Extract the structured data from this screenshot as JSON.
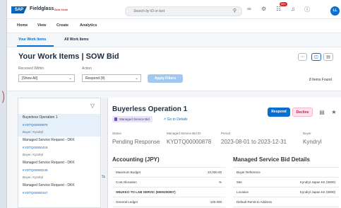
{
  "app": {
    "brand": "SAP",
    "name": "Fieldglass",
    "beta": "Beta Mode",
    "avatar": "LL",
    "notif_count": "99+"
  },
  "search": {
    "placeholder": "Search by ID or text"
  },
  "nav": {
    "items": [
      "Home",
      "View",
      "Create",
      "Analytics"
    ]
  },
  "tabs": {
    "items": [
      "Your Work Items",
      "All Work Items"
    ],
    "active": 0
  },
  "header": {
    "title": "Your Work Items | SOW Bid",
    "received_within_label": "Received Within",
    "received_within_value": "[Show All]",
    "action_label": "Action",
    "action_value": "Respond (8)",
    "apply_filters": "Apply Filters",
    "items_found": "8 Items Found"
  },
  "list": {
    "items": [
      {
        "title": "Buyerless Operation 1",
        "id": "KYDTQ00000878",
        "buyer": "Buyer: Kyndryl"
      },
      {
        "title": "Managed Service Request - DKK",
        "id": "KYDTQ00000418",
        "buyer": "Buyer: Kyndryl"
      },
      {
        "title": "Managed Service Request - DKK",
        "id": "KYDTQ00000249",
        "buyer": "Buyer: Kyndryl"
      },
      {
        "title": "Managed Service Request - DKK",
        "id": "KYDTQ00000167",
        "buyer": ""
      }
    ]
  },
  "detail": {
    "title": "Buyerless Operation 1",
    "tag": "Managed Service Bid",
    "goto": "Go to Details",
    "respond": "Respond",
    "decline": "Decline",
    "fields": [
      {
        "label": "Status",
        "value": "Pending Response"
      },
      {
        "label": "Managed Service Bid ID",
        "value": "KYDTQ00000878"
      },
      {
        "label": "Period",
        "value": "2023-08-01 to 2023-12-31"
      },
      {
        "label": "Buyer",
        "value": "Kyndryl"
      }
    ],
    "accounting": {
      "title": "Accounting (JPY)",
      "rows": [
        {
          "k": "Maximum Budget",
          "v": "10,000.00"
        },
        {
          "k": "Cost Allocation",
          "v": "%"
        },
        {
          "k": "SHUKKO TO LAB SERVIC (5000200007)",
          "v": ""
        },
        {
          "k": "General Ledger",
          "v": "100.000"
        }
      ]
    },
    "msbd": {
      "title": "Managed Service Bid Details",
      "rows": [
        {
          "k": "Buyer Reference",
          "v": ""
        },
        {
          "k": "Site",
          "v": "Kyndryl Japan KK (5000)"
        },
        {
          "k": "Location",
          "v": "Kyndryl Japan KK (5000)"
        },
        {
          "k": "Default Remit-to Address",
          "v": ""
        }
      ]
    }
  },
  "colors": {
    "accent": "#0a6ed1",
    "decline": "#c2185b",
    "tag": "#6c4dc4"
  },
  "icons": [
    "search-icon",
    "grid-icon",
    "settings-icon",
    "bell-icon",
    "help-icon",
    "filter-icon",
    "more-icon",
    "chat-icon",
    "star-icon",
    "splitter-icon"
  ]
}
